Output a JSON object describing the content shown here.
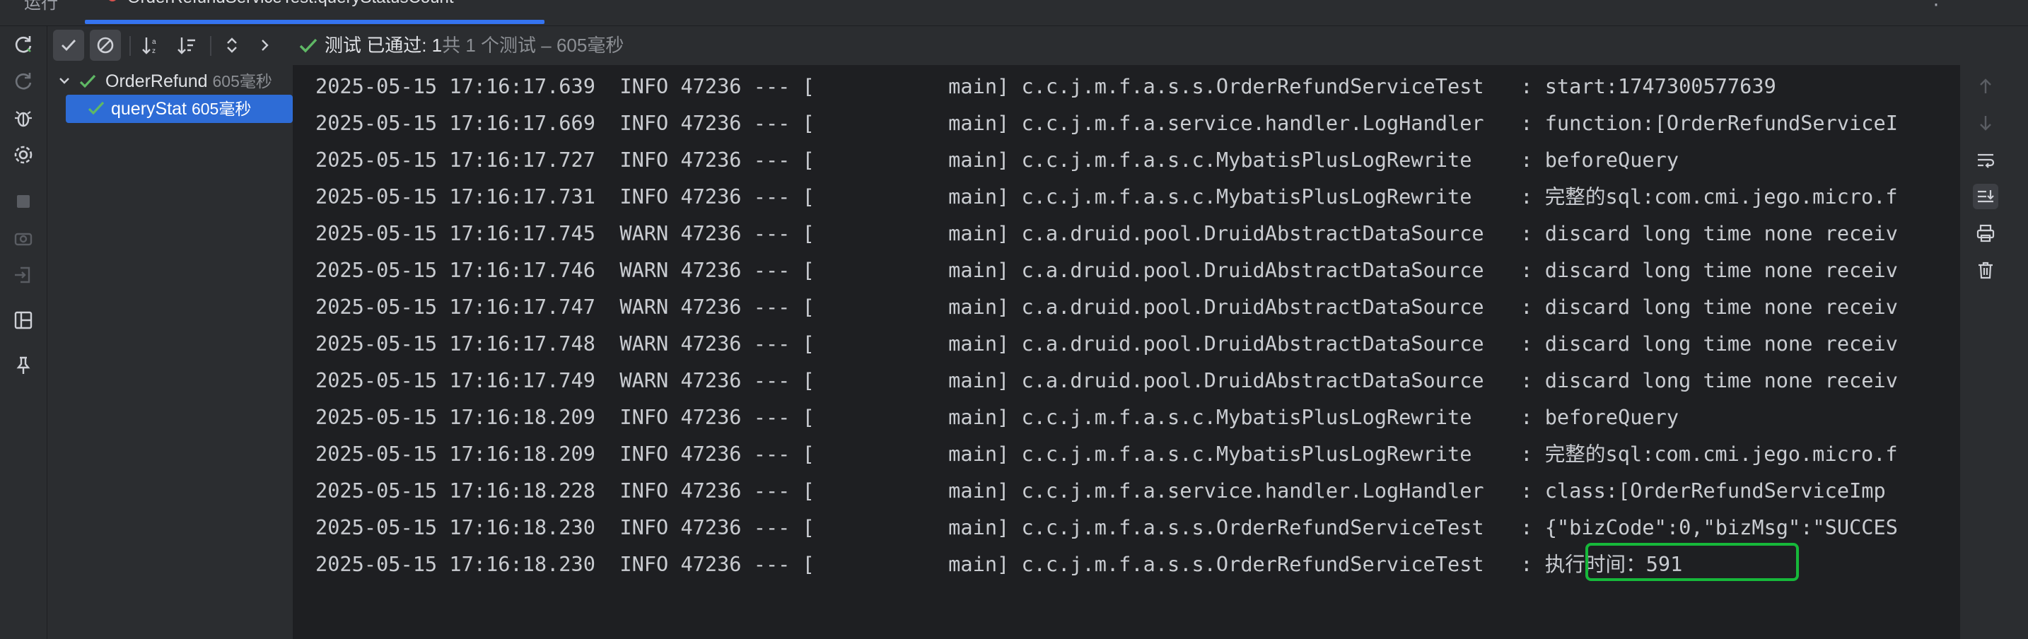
{
  "tabbar": {
    "run_label": "运行",
    "active_tab_label": "OrderRefundServiceTest.queryStatusCount",
    "close_glyph": "×",
    "more_glyph": "⋮"
  },
  "toolbar": {
    "status_title": "测试 已通过: 1",
    "status_detail": "共 1 个测试 – 605毫秒"
  },
  "tree": {
    "root": {
      "name": "OrderRefund",
      "time": "605毫秒"
    },
    "child": {
      "name": "queryStat",
      "time": "605毫秒"
    }
  },
  "console": {
    "lines": [
      {
        "text": "2025-05-15 17:16:17.639  INFO 47236 --- [           main] c.c.j.m.f.a.s.s.OrderRefundServiceTest   : start:1747300577639"
      },
      {
        "text": "2025-05-15 17:16:17.669  INFO 47236 --- [           main] c.c.j.m.f.a.service.handler.LogHandler   : function:[OrderRefundServiceI"
      },
      {
        "text": "2025-05-15 17:16:17.727  INFO 47236 --- [           main] c.c.j.m.f.a.s.c.MybatisPlusLogRewrite    : beforeQuery"
      },
      {
        "text": "2025-05-15 17:16:17.731  INFO 47236 --- [           main] c.c.j.m.f.a.s.c.MybatisPlusLogRewrite    : 完整的sql:com.cmi.jego.micro.f"
      },
      {
        "text": "2025-05-15 17:16:17.745  WARN 47236 --- [           main] c.a.druid.pool.DruidAbstractDataSource   : discard long time none receiv"
      },
      {
        "text": "2025-05-15 17:16:17.746  WARN 47236 --- [           main] c.a.druid.pool.DruidAbstractDataSource   : discard long time none receiv"
      },
      {
        "text": "2025-05-15 17:16:17.747  WARN 47236 --- [           main] c.a.druid.pool.DruidAbstractDataSource   : discard long time none receiv"
      },
      {
        "text": "2025-05-15 17:16:17.748  WARN 47236 --- [           main] c.a.druid.pool.DruidAbstractDataSource   : discard long time none receiv"
      },
      {
        "text": "2025-05-15 17:16:17.749  WARN 47236 --- [           main] c.a.druid.pool.DruidAbstractDataSource   : discard long time none receiv"
      },
      {
        "text": "2025-05-15 17:16:18.209  INFO 47236 --- [           main] c.c.j.m.f.a.s.c.MybatisPlusLogRewrite    : beforeQuery"
      },
      {
        "text": "2025-05-15 17:16:18.209  INFO 47236 --- [           main] c.c.j.m.f.a.s.c.MybatisPlusLogRewrite    : 完整的sql:com.cmi.jego.micro.f"
      },
      {
        "text": "2025-05-15 17:16:18.228  INFO 47236 --- [           main] c.c.j.m.f.a.service.handler.LogHandler   : class:[OrderRefundServiceImp"
      },
      {
        "text": "2025-05-15 17:16:18.230  INFO 47236 --- [           main] c.c.j.m.f.a.s.s.OrderRefundServiceTest   : {\"bizCode\":0,\"bizMsg\":\"SUCCES"
      },
      {
        "text": "2025-05-15 17:16:18.230  INFO 47236 --- [           main] c.c.j.m.f.a.s.s.OrderRefundServiceTest   : 执行时间：591"
      }
    ]
  },
  "colors": {
    "accent": "#3574f0",
    "pass_green": "#5fb865",
    "highlight_green": "#16b83a",
    "selection": "#2e6cd6"
  }
}
